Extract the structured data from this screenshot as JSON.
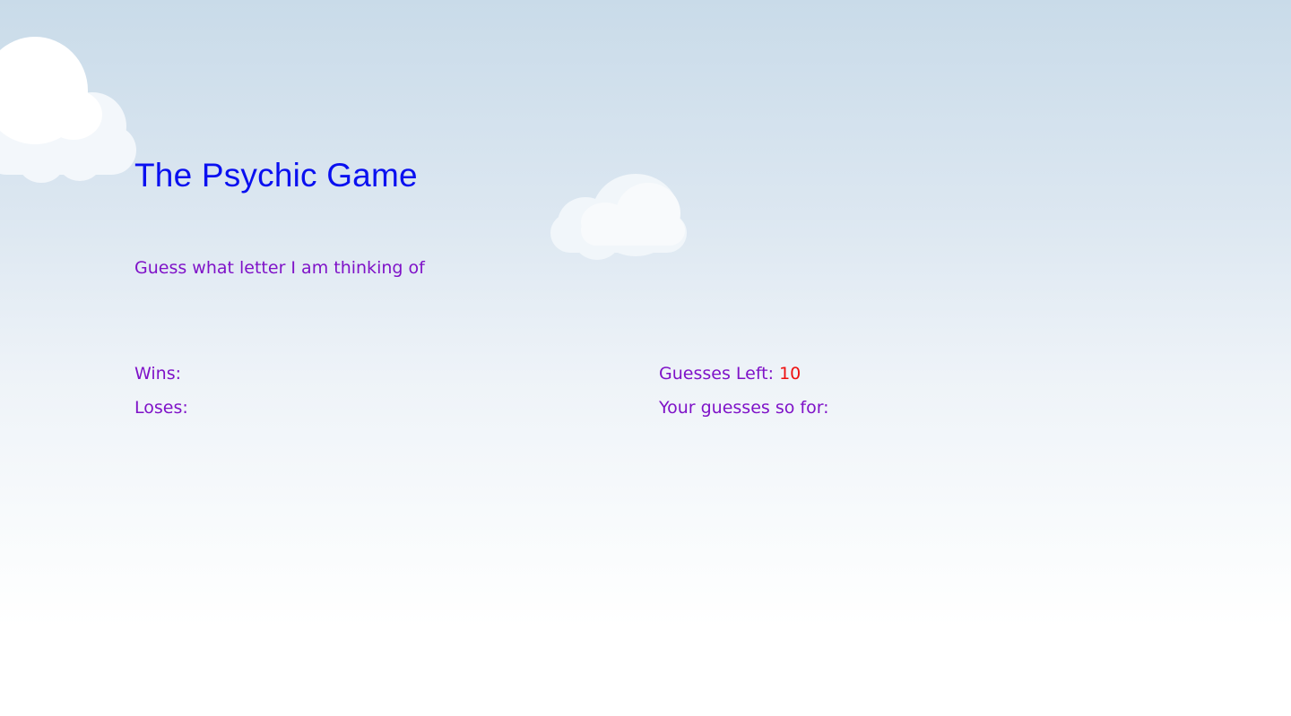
{
  "game": {
    "title": "The Psychic Game",
    "instructions": "Guess what letter I am thinking of"
  },
  "stats": {
    "wins_label": "Wins:",
    "wins_value": "",
    "loses_label": "Loses:",
    "loses_value": "",
    "guesses_left_label": "Guesses Left:",
    "guesses_left_value": "10",
    "guesses_so_far_label": "Your guesses so for:",
    "guesses_so_far_value": ""
  },
  "colors": {
    "title": "#0a10f0",
    "text": "#7f12c8",
    "value_highlight": "#ef1010",
    "sky_top": "#c9dbe9",
    "sky_bottom": "#ffffff"
  }
}
